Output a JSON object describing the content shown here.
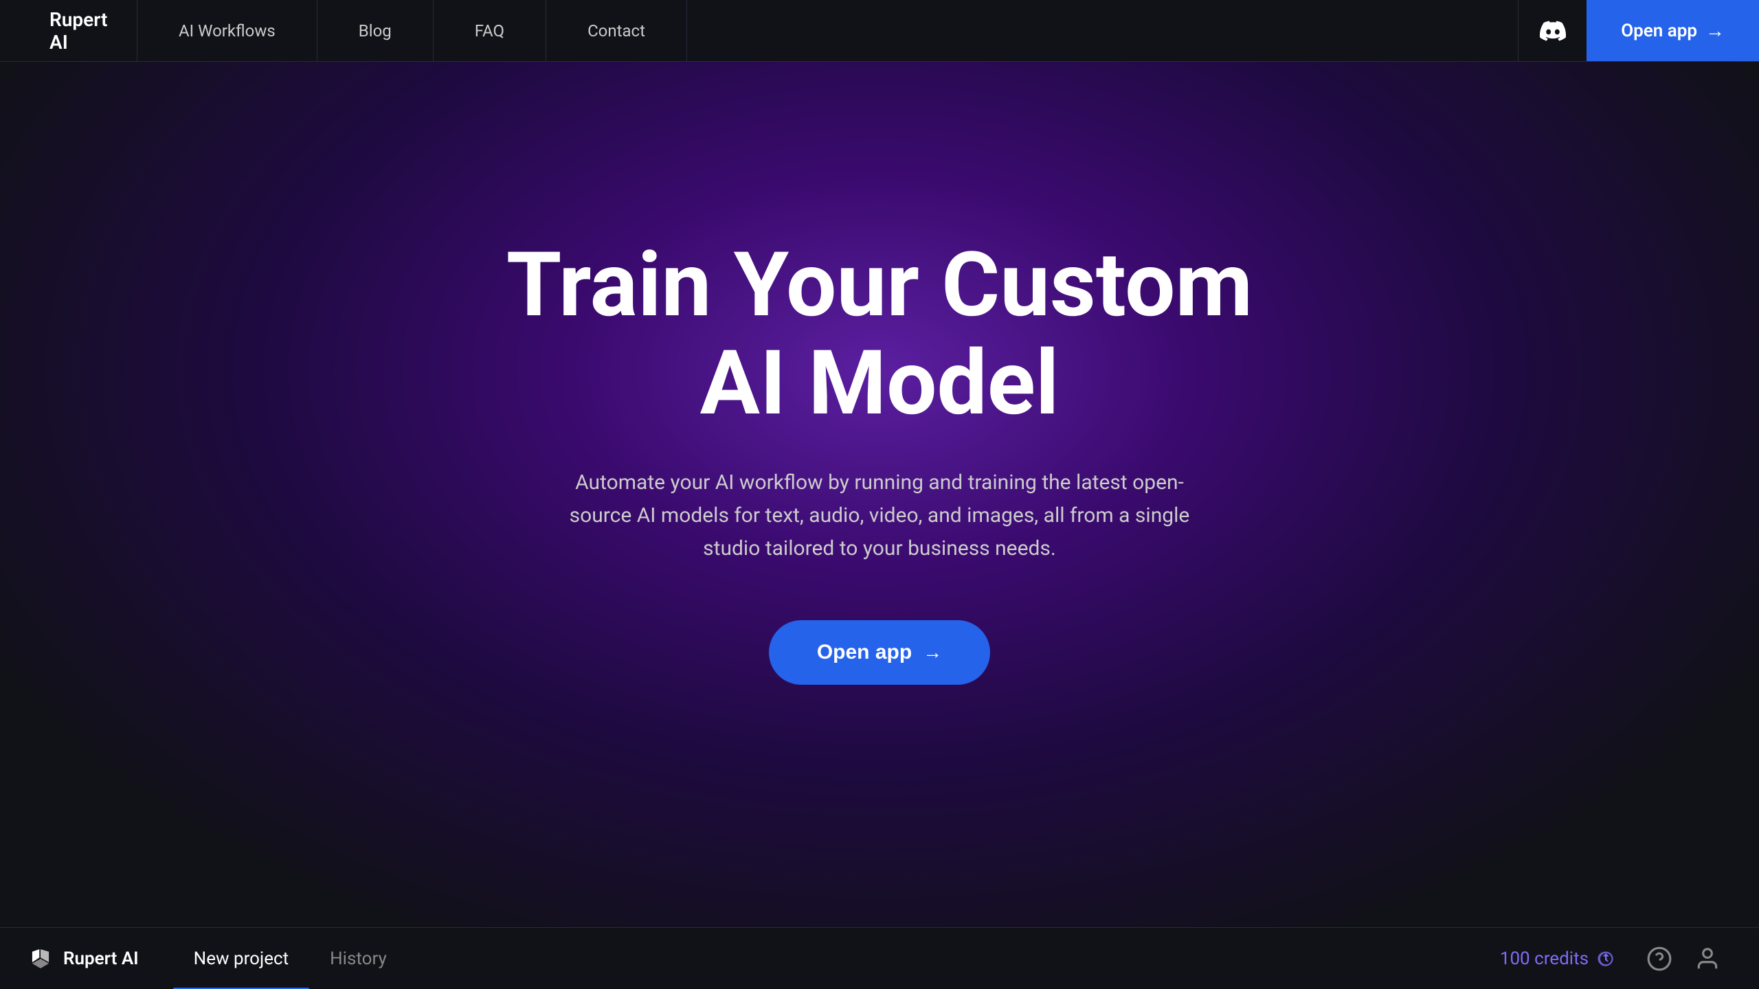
{
  "nav": {
    "logo_text": "Rupert AI",
    "links": [
      {
        "label": "AI Workflows",
        "id": "ai-workflows"
      },
      {
        "label": "Blog",
        "id": "blog"
      },
      {
        "label": "FAQ",
        "id": "faq"
      },
      {
        "label": "Contact",
        "id": "contact"
      }
    ],
    "open_app_label": "Open app",
    "arrow": "→"
  },
  "hero": {
    "title": "Train Your Custom AI Model",
    "subtitle": "Automate your AI workflow by running and training the latest open-source AI models for text, audio, video, and images, all from a single studio tailored to your business needs.",
    "cta_label": "Open app",
    "cta_arrow": "→"
  },
  "bottom_bar": {
    "logo_text": "Rupert AI",
    "tabs": [
      {
        "label": "New project",
        "id": "new-project",
        "active": true
      },
      {
        "label": "History",
        "id": "history",
        "active": false
      }
    ],
    "credits_label": "100 credits",
    "credits_icon": "⟳"
  }
}
